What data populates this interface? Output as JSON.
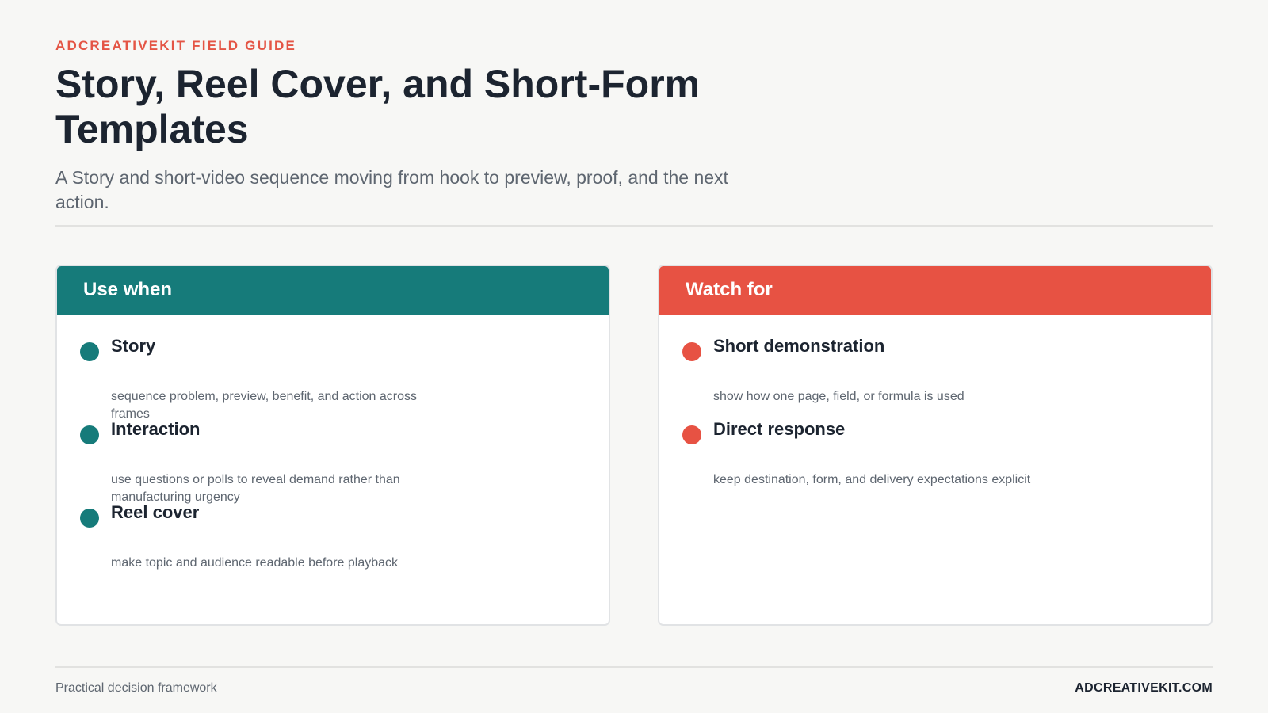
{
  "header": {
    "eyebrow": "ADCREATIVEKIT FIELD GUIDE",
    "title": "Story, Reel Cover, and Short-Form Templates",
    "subtitle": "A Story and short-video sequence moving from hook to preview, proof, and the next action."
  },
  "colors": {
    "teal": "#167b7a",
    "coral": "#e75243",
    "eyebrow": "#e45545",
    "background": "#f7f7f5"
  },
  "use_when": {
    "heading": "Use when",
    "items": [
      {
        "title": "Story",
        "description": "sequence problem, preview, benefit, and action across frames"
      },
      {
        "title": "Interaction",
        "description": "use questions or polls to reveal demand rather than manufacturing urgency"
      },
      {
        "title": "Reel cover",
        "description": "make topic and audience readable before playback"
      }
    ]
  },
  "watch_for": {
    "heading": "Watch for",
    "items": [
      {
        "title": "Short demonstration",
        "description": "show how one page, field, or formula is used"
      },
      {
        "title": "Direct response",
        "description": "keep destination, form, and delivery expectations explicit"
      }
    ]
  },
  "footer": {
    "left": "Practical decision framework",
    "right": "ADCREATIVEKIT.COM"
  }
}
